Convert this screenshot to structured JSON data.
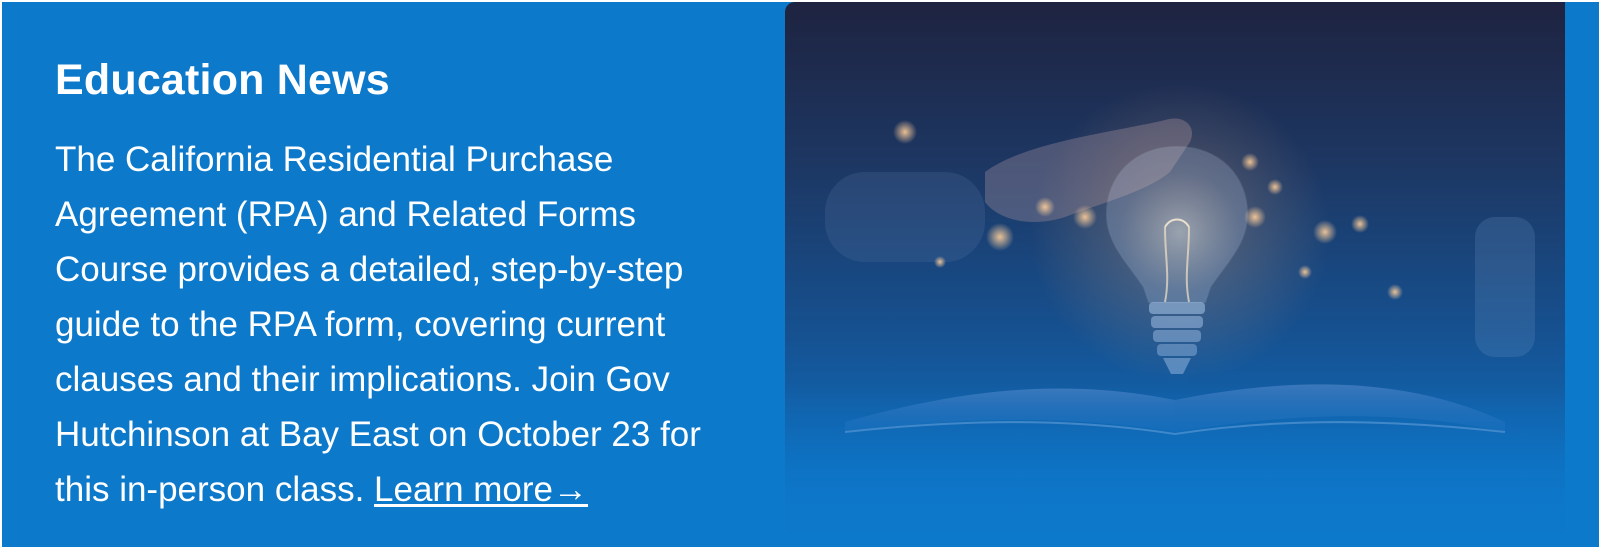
{
  "news": {
    "heading": "Education News",
    "body": "The California Residential Purchase Agreement (RPA) and Related Forms Course provides a detailed, step-by-step guide to the RPA form, covering current clauses and their implications. Join Gov Hutchinson at Bay East on October 23 for this in-person class. ",
    "link_label": "Learn more→",
    "image": {
      "icon": "lightbulb-book-illustration"
    }
  },
  "colors": {
    "card_background": "#0d79cb",
    "text": "#ffffff"
  }
}
